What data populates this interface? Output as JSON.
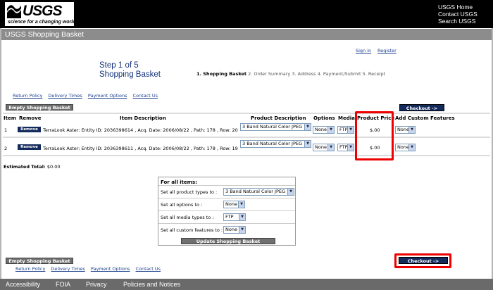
{
  "header": {
    "logo_text": "USGS",
    "logo_tagline": "science for a changing world",
    "links": [
      "USGS Home",
      "Contact USGS",
      "Search USGS"
    ]
  },
  "page_title": "USGS Shopping Basket",
  "account": {
    "signin": "Sign in",
    "register": "Register"
  },
  "step": {
    "line1": "Step 1 of 5",
    "line2": "Shopping Basket"
  },
  "steps": [
    "1. Shopping Basket",
    "2. Order Summary",
    "3. Address",
    "4. Payment/Submit",
    "5. Receipt"
  ],
  "help_links": [
    "Return Policy",
    "Delivery Times",
    "Payment Options",
    "Contact Us"
  ],
  "buttons": {
    "empty": "Empty Shopping Basket",
    "checkout": "Checkout ->",
    "update": "Update Shopping Basket"
  },
  "table": {
    "headers": {
      "item": "Item",
      "remove": "Remove",
      "description": "Item Description",
      "product_description": "Product Description",
      "options": "Options",
      "media": "Media",
      "price": "Product Price",
      "custom": "Add Custom Features"
    },
    "rows": [
      {
        "item": "1",
        "remove": "Remove",
        "description": "TerraLook Aster: Entity ID: 2036398614 , Acq. Date: 2006/08/22 , Path: 178 , Row: 20",
        "product": "3 Band Natural Color JPEG",
        "option": "None",
        "media": "FTP",
        "price": "$.00",
        "custom": "None"
      },
      {
        "item": "2",
        "remove": "Remove",
        "description": "TerraLook Aster: Entity ID: 2036398611 , Acq. Date: 2006/08/22 , Path: 178 , Row: 19",
        "product": "3 Band Natural Color JPEG",
        "option": "None",
        "media": "FTP",
        "price": "$.00",
        "custom": "None"
      }
    ]
  },
  "estimated": {
    "label": "Estimated Total:",
    "value": "$0.00"
  },
  "all_items": {
    "title": "For all items:",
    "rows": [
      {
        "label": "Set all product types to :",
        "value": "3 Band Natural Color JPEG"
      },
      {
        "label": "Set all options to :",
        "value": "None"
      },
      {
        "label": "Set all media types to :",
        "value": "FTP"
      },
      {
        "label": "Set all custom features to :",
        "value": "None"
      }
    ]
  },
  "footer": [
    "Accessibility",
    "FOIA",
    "Privacy",
    "Policies and Notices"
  ],
  "colors": {
    "highlight": "#ee0000",
    "navy": "#132a5c",
    "titlebar": "#8c8c8c"
  }
}
